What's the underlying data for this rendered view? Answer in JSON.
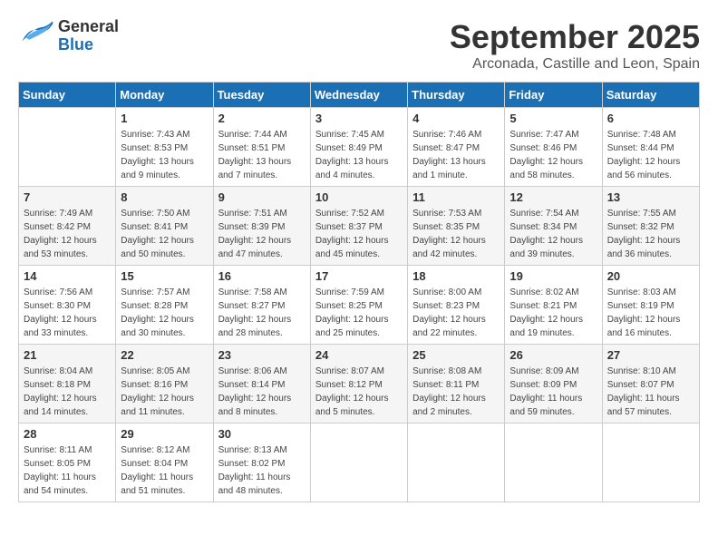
{
  "header": {
    "logo_general": "General",
    "logo_blue": "Blue",
    "month": "September 2025",
    "location": "Arconada, Castille and Leon, Spain"
  },
  "weekdays": [
    "Sunday",
    "Monday",
    "Tuesday",
    "Wednesday",
    "Thursday",
    "Friday",
    "Saturday"
  ],
  "weeks": [
    [
      {
        "day": "",
        "sunrise": "",
        "sunset": "",
        "daylight": ""
      },
      {
        "day": "1",
        "sunrise": "Sunrise: 7:43 AM",
        "sunset": "Sunset: 8:53 PM",
        "daylight": "Daylight: 13 hours and 9 minutes."
      },
      {
        "day": "2",
        "sunrise": "Sunrise: 7:44 AM",
        "sunset": "Sunset: 8:51 PM",
        "daylight": "Daylight: 13 hours and 7 minutes."
      },
      {
        "day": "3",
        "sunrise": "Sunrise: 7:45 AM",
        "sunset": "Sunset: 8:49 PM",
        "daylight": "Daylight: 13 hours and 4 minutes."
      },
      {
        "day": "4",
        "sunrise": "Sunrise: 7:46 AM",
        "sunset": "Sunset: 8:47 PM",
        "daylight": "Daylight: 13 hours and 1 minute."
      },
      {
        "day": "5",
        "sunrise": "Sunrise: 7:47 AM",
        "sunset": "Sunset: 8:46 PM",
        "daylight": "Daylight: 12 hours and 58 minutes."
      },
      {
        "day": "6",
        "sunrise": "Sunrise: 7:48 AM",
        "sunset": "Sunset: 8:44 PM",
        "daylight": "Daylight: 12 hours and 56 minutes."
      }
    ],
    [
      {
        "day": "7",
        "sunrise": "Sunrise: 7:49 AM",
        "sunset": "Sunset: 8:42 PM",
        "daylight": "Daylight: 12 hours and 53 minutes."
      },
      {
        "day": "8",
        "sunrise": "Sunrise: 7:50 AM",
        "sunset": "Sunset: 8:41 PM",
        "daylight": "Daylight: 12 hours and 50 minutes."
      },
      {
        "day": "9",
        "sunrise": "Sunrise: 7:51 AM",
        "sunset": "Sunset: 8:39 PM",
        "daylight": "Daylight: 12 hours and 47 minutes."
      },
      {
        "day": "10",
        "sunrise": "Sunrise: 7:52 AM",
        "sunset": "Sunset: 8:37 PM",
        "daylight": "Daylight: 12 hours and 45 minutes."
      },
      {
        "day": "11",
        "sunrise": "Sunrise: 7:53 AM",
        "sunset": "Sunset: 8:35 PM",
        "daylight": "Daylight: 12 hours and 42 minutes."
      },
      {
        "day": "12",
        "sunrise": "Sunrise: 7:54 AM",
        "sunset": "Sunset: 8:34 PM",
        "daylight": "Daylight: 12 hours and 39 minutes."
      },
      {
        "day": "13",
        "sunrise": "Sunrise: 7:55 AM",
        "sunset": "Sunset: 8:32 PM",
        "daylight": "Daylight: 12 hours and 36 minutes."
      }
    ],
    [
      {
        "day": "14",
        "sunrise": "Sunrise: 7:56 AM",
        "sunset": "Sunset: 8:30 PM",
        "daylight": "Daylight: 12 hours and 33 minutes."
      },
      {
        "day": "15",
        "sunrise": "Sunrise: 7:57 AM",
        "sunset": "Sunset: 8:28 PM",
        "daylight": "Daylight: 12 hours and 30 minutes."
      },
      {
        "day": "16",
        "sunrise": "Sunrise: 7:58 AM",
        "sunset": "Sunset: 8:27 PM",
        "daylight": "Daylight: 12 hours and 28 minutes."
      },
      {
        "day": "17",
        "sunrise": "Sunrise: 7:59 AM",
        "sunset": "Sunset: 8:25 PM",
        "daylight": "Daylight: 12 hours and 25 minutes."
      },
      {
        "day": "18",
        "sunrise": "Sunrise: 8:00 AM",
        "sunset": "Sunset: 8:23 PM",
        "daylight": "Daylight: 12 hours and 22 minutes."
      },
      {
        "day": "19",
        "sunrise": "Sunrise: 8:02 AM",
        "sunset": "Sunset: 8:21 PM",
        "daylight": "Daylight: 12 hours and 19 minutes."
      },
      {
        "day": "20",
        "sunrise": "Sunrise: 8:03 AM",
        "sunset": "Sunset: 8:19 PM",
        "daylight": "Daylight: 12 hours and 16 minutes."
      }
    ],
    [
      {
        "day": "21",
        "sunrise": "Sunrise: 8:04 AM",
        "sunset": "Sunset: 8:18 PM",
        "daylight": "Daylight: 12 hours and 14 minutes."
      },
      {
        "day": "22",
        "sunrise": "Sunrise: 8:05 AM",
        "sunset": "Sunset: 8:16 PM",
        "daylight": "Daylight: 12 hours and 11 minutes."
      },
      {
        "day": "23",
        "sunrise": "Sunrise: 8:06 AM",
        "sunset": "Sunset: 8:14 PM",
        "daylight": "Daylight: 12 hours and 8 minutes."
      },
      {
        "day": "24",
        "sunrise": "Sunrise: 8:07 AM",
        "sunset": "Sunset: 8:12 PM",
        "daylight": "Daylight: 12 hours and 5 minutes."
      },
      {
        "day": "25",
        "sunrise": "Sunrise: 8:08 AM",
        "sunset": "Sunset: 8:11 PM",
        "daylight": "Daylight: 12 hours and 2 minutes."
      },
      {
        "day": "26",
        "sunrise": "Sunrise: 8:09 AM",
        "sunset": "Sunset: 8:09 PM",
        "daylight": "Daylight: 11 hours and 59 minutes."
      },
      {
        "day": "27",
        "sunrise": "Sunrise: 8:10 AM",
        "sunset": "Sunset: 8:07 PM",
        "daylight": "Daylight: 11 hours and 57 minutes."
      }
    ],
    [
      {
        "day": "28",
        "sunrise": "Sunrise: 8:11 AM",
        "sunset": "Sunset: 8:05 PM",
        "daylight": "Daylight: 11 hours and 54 minutes."
      },
      {
        "day": "29",
        "sunrise": "Sunrise: 8:12 AM",
        "sunset": "Sunset: 8:04 PM",
        "daylight": "Daylight: 11 hours and 51 minutes."
      },
      {
        "day": "30",
        "sunrise": "Sunrise: 8:13 AM",
        "sunset": "Sunset: 8:02 PM",
        "daylight": "Daylight: 11 hours and 48 minutes."
      },
      {
        "day": "",
        "sunrise": "",
        "sunset": "",
        "daylight": ""
      },
      {
        "day": "",
        "sunrise": "",
        "sunset": "",
        "daylight": ""
      },
      {
        "day": "",
        "sunrise": "",
        "sunset": "",
        "daylight": ""
      },
      {
        "day": "",
        "sunrise": "",
        "sunset": "",
        "daylight": ""
      }
    ]
  ]
}
